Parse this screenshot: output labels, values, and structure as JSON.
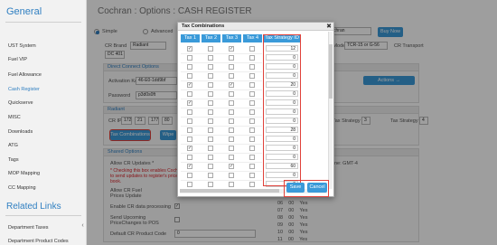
{
  "sidebar": {
    "title": "General",
    "items": [
      "UST System",
      "Fuel VIP",
      "Fuel Allowance",
      "Cash Register",
      "Quickserve",
      "MISC",
      "Downloads",
      "ATG",
      "Tags",
      "MOP Mapping",
      "CC Mapping"
    ],
    "active_index": 3,
    "related_title": "Related Links",
    "related_items": [
      "Department Taxes",
      "Department Product Codes"
    ]
  },
  "header": {
    "title": "Cochran : Options : CASH REGISTER",
    "buy_now": "Buy Now"
  },
  "mode": {
    "simple": "Simple",
    "advanced": "Advanced",
    "selected": "simple"
  },
  "cr": {
    "brand_label": "CR Brand",
    "brand_value": "Radiant",
    "brand_value2": "DC 401",
    "model_label": "CR Model",
    "model_value": "TCR-15 or G-56",
    "transport_label": "CR Transport",
    "right_value": "chran"
  },
  "direct": {
    "title": "Direct Connect Options",
    "activation_label": "Activation Key",
    "activation_value": "46-E0-1dd9bf",
    "password_label": "Password",
    "password_value": "p3d0s0ft",
    "actions": "Actions →"
  },
  "radiant": {
    "title": "Radiant",
    "ip_label": "CR IP",
    "ip": [
      "172",
      "21",
      "177",
      "80"
    ],
    "tax_combinations": "Tax Combinations",
    "wipe": "Wipe",
    "ts3_label": "Tax Strategy 3",
    "ts3_value": "3",
    "ts4_label": "Tax Strategy 4",
    "ts4_value": "4"
  },
  "shared": {
    "title": "Shared Options",
    "allow_updates": "Allow CR Updates *",
    "warning": "* Checking this box enables Cochran to send updates to register's price book.",
    "allow_fuel": "Allow CR Fuel Prices Update",
    "enable_data": "Enable CR data processing",
    "send_pricechanges": "Send Upcoming PriceChanges to POS",
    "default_code": "Default CR Product Code",
    "default_code_value": "0",
    "timezone": "ne: GMT-4"
  },
  "bg_table": {
    "rows": [
      [
        "06",
        "00",
        "Yes"
      ],
      [
        "07",
        "00",
        "Yes"
      ],
      [
        "08",
        "00",
        "Yes"
      ],
      [
        "09",
        "00",
        "Yes"
      ],
      [
        "10",
        "00",
        "Yes"
      ],
      [
        "11",
        "00",
        "Yes"
      ]
    ]
  },
  "modal": {
    "title": "Tax Combinations",
    "close": "✖",
    "headers": [
      "Tax 1",
      "Tax 2",
      "Tax 3",
      "Tax 4",
      "Tax Strategy ID"
    ],
    "rows": [
      {
        "c": [
          true,
          false,
          true,
          false
        ],
        "id": "12"
      },
      {
        "c": [
          false,
          false,
          false,
          false
        ],
        "id": "0"
      },
      {
        "c": [
          false,
          false,
          false,
          false
        ],
        "id": "0"
      },
      {
        "c": [
          false,
          false,
          false,
          false
        ],
        "id": "0"
      },
      {
        "c": [
          true,
          false,
          true,
          false
        ],
        "id": "20"
      },
      {
        "c": [
          false,
          false,
          false,
          false
        ],
        "id": "0"
      },
      {
        "c": [
          true,
          false,
          false,
          false
        ],
        "id": "0"
      },
      {
        "c": [
          false,
          false,
          false,
          false
        ],
        "id": "0"
      },
      {
        "c": [
          false,
          false,
          false,
          false
        ],
        "id": "0"
      },
      {
        "c": [
          false,
          false,
          false,
          false
        ],
        "id": "28"
      },
      {
        "c": [
          false,
          false,
          false,
          false
        ],
        "id": "0"
      },
      {
        "c": [
          true,
          false,
          false,
          false
        ],
        "id": "0"
      },
      {
        "c": [
          false,
          false,
          false,
          false
        ],
        "id": "0"
      },
      {
        "c": [
          true,
          false,
          true,
          false
        ],
        "id": "60"
      },
      {
        "c": [
          false,
          false,
          false,
          false
        ],
        "id": "0"
      },
      {
        "c": [
          false,
          false,
          false,
          false
        ],
        "id": "0"
      }
    ],
    "save": "Save",
    "cancel": "Cancel"
  },
  "colors": {
    "accent": "#3a9ad9",
    "highlight": "#e0413a",
    "title_blue": "#2f7fc1"
  }
}
